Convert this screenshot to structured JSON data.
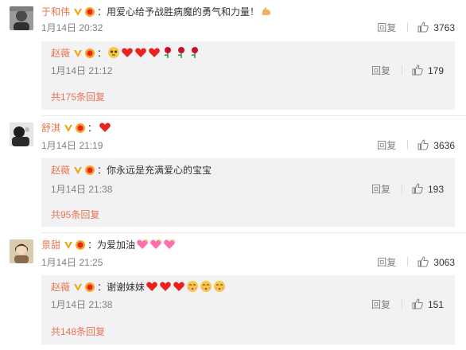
{
  "comments": [
    {
      "user": "于和伟",
      "text": "：用爱心给予战胜病魔的勇气和力量！",
      "emoji": [
        "flexed-biceps"
      ],
      "time": "1月14日 20:32",
      "reply_label": "回复",
      "likes": "3763",
      "reply": {
        "user": "赵薇",
        "text": "：",
        "emoji": [
          "pleading-face",
          "heart",
          "heart",
          "heart",
          "rose",
          "rose",
          "rose"
        ],
        "time": "1月14日 21:12",
        "reply_label": "回复",
        "likes": "179"
      },
      "more": "共175条回复"
    },
    {
      "user": "舒淇",
      "text": "：",
      "emoji": [
        "heart"
      ],
      "time": "1月14日 21:19",
      "reply_label": "回复",
      "likes": "3636",
      "reply": {
        "user": "赵薇",
        "text": "：你永远是充满爱心的宝宝",
        "emoji": [],
        "time": "1月14日 21:38",
        "reply_label": "回复",
        "likes": "193"
      },
      "more": "共95条回复"
    },
    {
      "user": "景甜",
      "text": "：为爱加油",
      "emoji": [
        "sparkling-heart",
        "sparkling-heart",
        "sparkling-heart"
      ],
      "time": "1月14日 21:25",
      "reply_label": "回复",
      "likes": "3063",
      "reply": {
        "user": "赵薇",
        "text": "：谢谢妹妹",
        "emoji": [
          "heart",
          "heart",
          "heart",
          "kissing-face",
          "kissing-face",
          "kissing-face"
        ],
        "time": "1月14日 21:38",
        "reply_label": "回复",
        "likes": "151"
      },
      "more": "共148条回复"
    }
  ],
  "colors": {
    "username": "#eb7350",
    "meta": "#808080",
    "reply_bg": "#f2f2f5",
    "heart": "#e8231f",
    "vip": "#f0a500"
  }
}
